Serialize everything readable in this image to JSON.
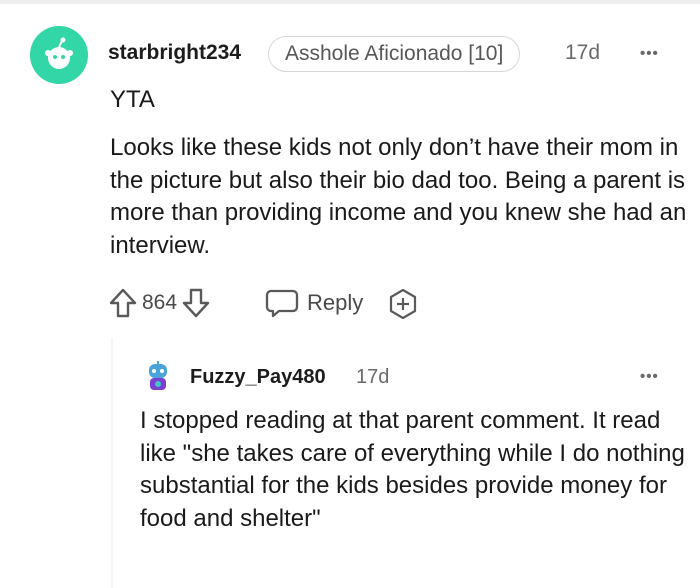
{
  "comment": {
    "username": "starbright234",
    "flair": "Asshole Aficionado [10]",
    "timestamp": "17d",
    "more_label": "•••",
    "verdict": "YTA",
    "body": "Looks like these kids not only don’t have their mom in the picture but also their bio dad too. Being a parent is more than providing income and you knew she had an interview.",
    "score": "864",
    "reply_label": "Reply",
    "icons": {
      "avatar": "reddit-snoo-icon",
      "upvote": "upvote-arrow-icon",
      "downvote": "downvote-arrow-icon",
      "reply": "speech-bubble-icon",
      "award": "add-award-icon",
      "more": "ellipsis-icon"
    }
  },
  "reply": {
    "username": "Fuzzy_Pay480",
    "timestamp": "17d",
    "more_label": "•••",
    "body": "I stopped reading at that parent comment. It read like \"she takes care of everything while I do nothing substantial for the kids besides provide money for food and shelter\"",
    "icons": {
      "avatar": "snoo-avatar-icon",
      "more": "ellipsis-icon"
    }
  },
  "colors": {
    "avatar_bg": "#33d6a6",
    "text": "#1a1a1b",
    "meta": "#6a6a6a",
    "flair_border": "#d7d7d7"
  }
}
